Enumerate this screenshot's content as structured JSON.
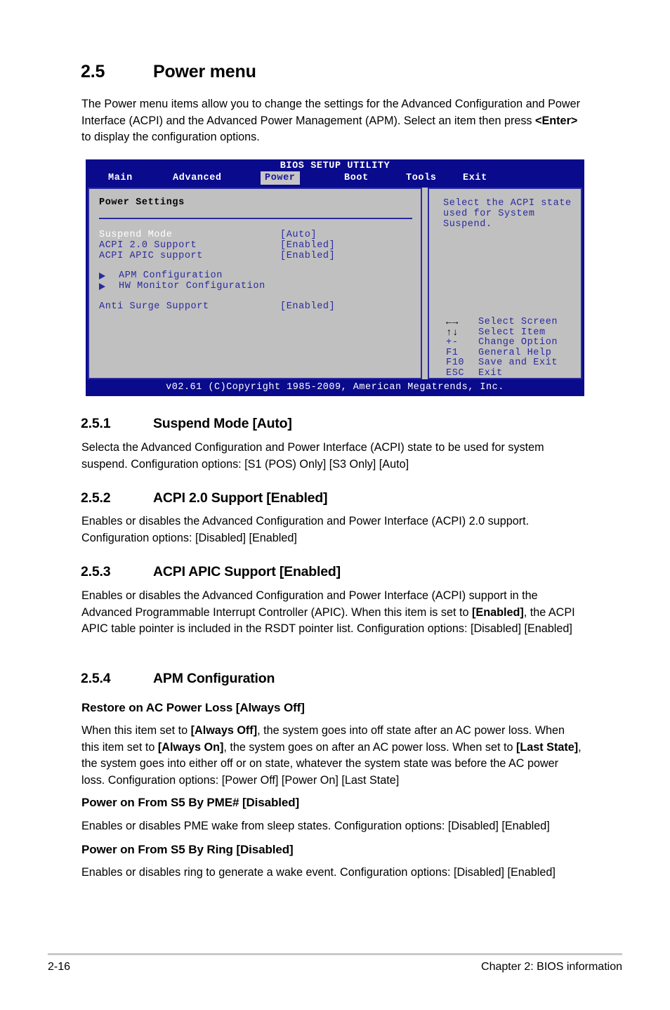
{
  "section": {
    "number": "2.5",
    "title": "Power menu",
    "intro": "The Power menu items allow you to change the settings for the Advanced Configuration and Power Interface (ACPI) and the Advanced Power Management (APM). Select an item then press <Enter> to display the configuration options."
  },
  "bios": {
    "title": "BIOS SETUP UTILITY",
    "tabs": [
      {
        "label": "Main",
        "active": false
      },
      {
        "label": "Advanced",
        "active": false
      },
      {
        "label": "Power",
        "active": true
      },
      {
        "label": "Boot",
        "active": false
      },
      {
        "label": "Tools",
        "active": false
      },
      {
        "label": "Exit",
        "active": false
      }
    ],
    "panel_title": "Power Settings",
    "items": [
      {
        "label": "Suspend Mode",
        "value": "[Auto]"
      },
      {
        "label": "ACPI 2.0 Support",
        "value": "[Enabled]"
      },
      {
        "label": "ACPI APIC support",
        "value": "[Enabled]"
      },
      {
        "label": "APM Configuration",
        "value": ""
      },
      {
        "label": "HW Monitor Configuration",
        "value": ""
      },
      {
        "label": "Anti Surge Support",
        "value": "[Enabled]"
      }
    ],
    "help_text": "Select the ACPI state used for System Suspend.",
    "keys": [
      {
        "glyph": "←→",
        "code": "",
        "desc": "Select Screen"
      },
      {
        "glyph": "↑↓",
        "code": "",
        "desc": "Select Item"
      },
      {
        "glyph": "",
        "code": "+-",
        "desc": "Change Option"
      },
      {
        "glyph": "",
        "code": "F1",
        "desc": "General Help"
      },
      {
        "glyph": "",
        "code": "F10",
        "desc": "Save and Exit"
      },
      {
        "glyph": "",
        "code": "ESC",
        "desc": "Exit"
      }
    ],
    "footer": "v02.61 (C)Copyright 1985-2009, American Megatrends, Inc."
  },
  "subsections": {
    "s251": {
      "number": "2.5.1",
      "title": "Suspend Mode [Auto]",
      "body": "Selecta the Advanced Configuration and Power Interface (ACPI) state to be used for system suspend. Configuration options: [S1 (POS) Only] [S3 Only] [Auto]"
    },
    "s252": {
      "number": "2.5.2",
      "title": "ACPI 2.0 Support [Enabled]",
      "body": "Enables or disables the Advanced Configuration and Power Interface (ACPI) 2.0 support. Configuration options: [Disabled] [Enabled]"
    },
    "s253": {
      "number": "2.5.3",
      "title": "ACPI APIC Support [Enabled]",
      "body_part1": "Enables or disables the Advanced Configuration and Power Interface (ACPI) support in the Advanced Programmable Interrupt Controller (APIC). When this item is set to ",
      "body_bold1": "[Enabled]",
      "body_part2": ", the ACPI APIC table pointer is included in the RSDT pointer list. Configuration options: [Disabled] [Enabled]"
    },
    "s254": {
      "number": "2.5.4",
      "title": "APM Configuration",
      "item1": {
        "title": "Restore on AC Power Loss [Always Off]",
        "p1": "When this item set to ",
        "b1": "[Always Off]",
        "p2": ", the system goes into off state after an AC power loss. When this item set to ",
        "b2": "[Always On]",
        "p3": ", the system goes on after an AC power loss. When set to ",
        "b3": "[Last State]",
        "p4": ", the system goes into either off or on state, whatever the system state was before the AC power loss. Configuration options: [Power Off] [Power On] [Last State]"
      },
      "item2": {
        "title": "Power on From S5 By PME# [Disabled]",
        "body": "Enables or disables PME wake from sleep states. Configuration options: [Disabled] [Enabled]"
      },
      "item3": {
        "title": "Power on From S5 By Ring [Disabled]",
        "body": "Enables or disables ring to generate a wake event. Configuration options: [Disabled] [Enabled]"
      }
    }
  },
  "page_footer": {
    "page_number": "2-16",
    "chapter": "Chapter 2: BIOS information"
  }
}
